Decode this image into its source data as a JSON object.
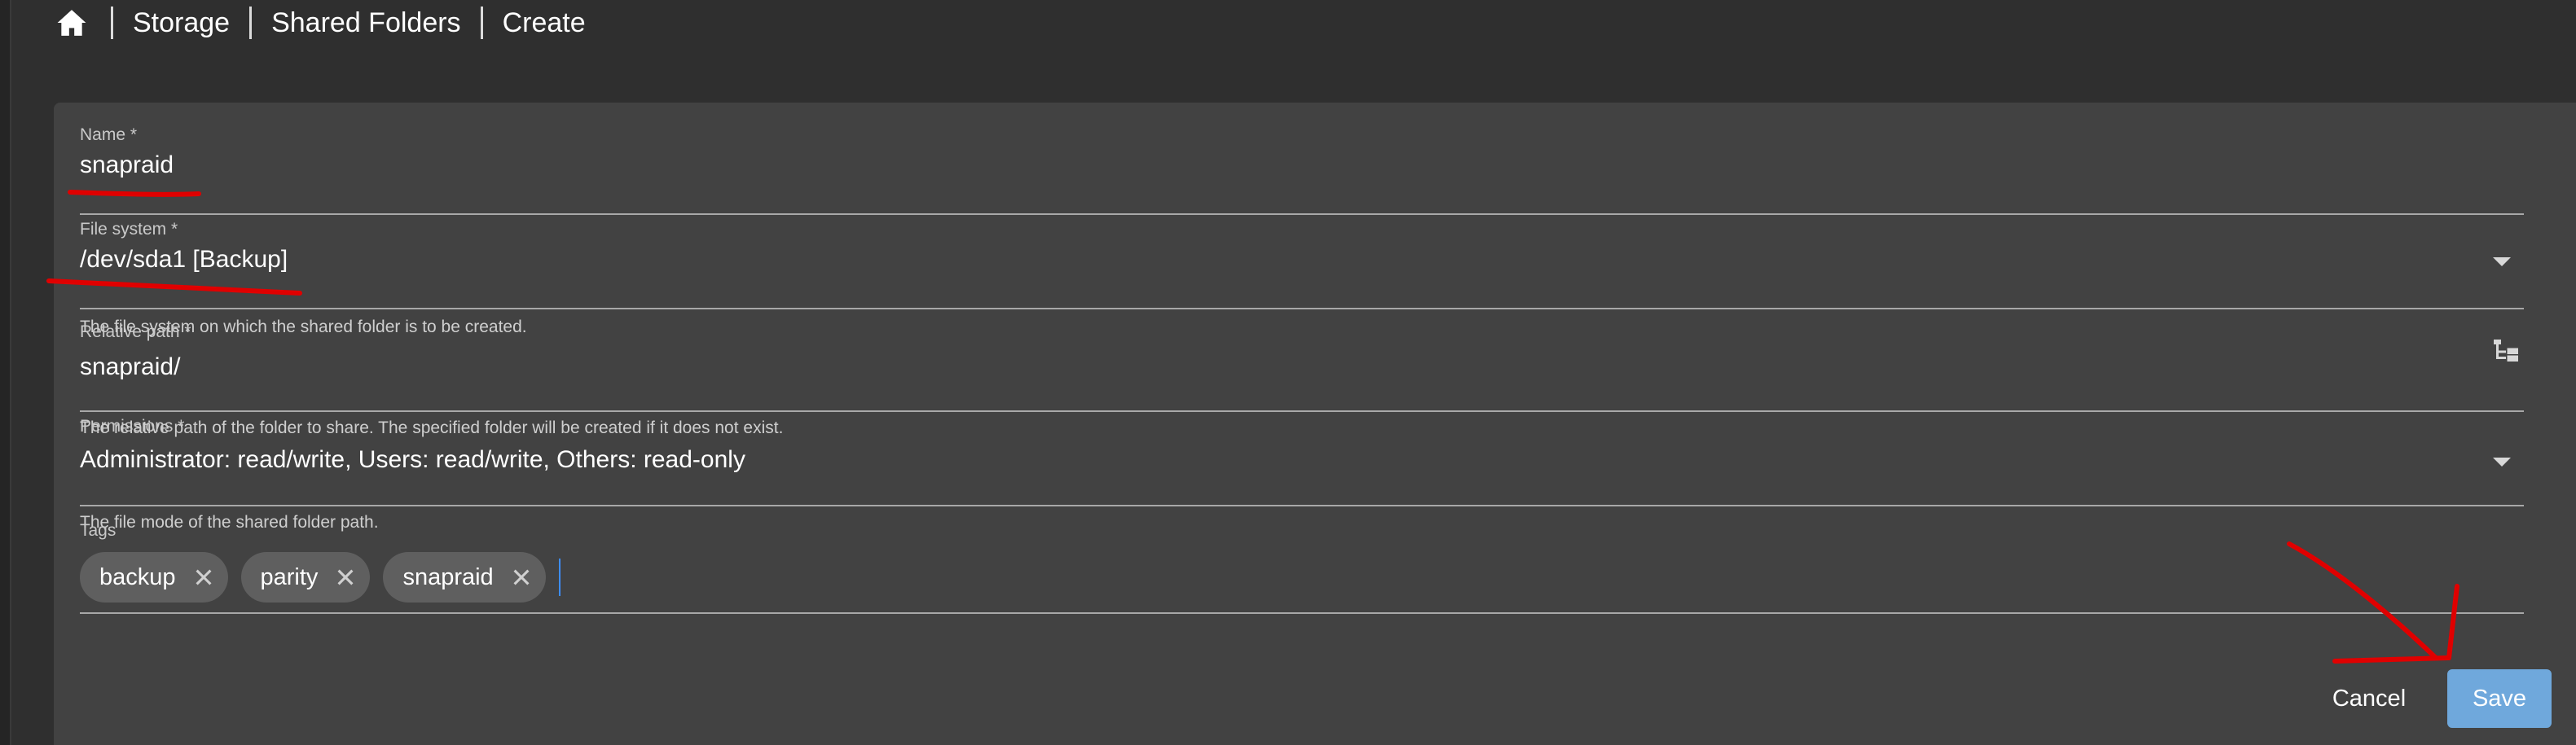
{
  "breadcrumb": {
    "home_icon": "home-icon",
    "items": [
      "Storage",
      "Shared Folders"
    ],
    "current": "Create"
  },
  "form": {
    "name": {
      "label": "Name *",
      "value": "snapraid"
    },
    "file_system": {
      "label": "File system *",
      "value": "/dev/sda1 [Backup]",
      "hint": "The file system on which the shared folder is to be created."
    },
    "relative_path": {
      "label": "Relative path *",
      "value": "snapraid/",
      "hint": "The relative path of the folder to share. The specified folder will be created if it does not exist."
    },
    "permissions": {
      "label": "Permissions *",
      "value": "Administrator: read/write, Users: read/write, Others: read-only",
      "hint": "The file mode of the shared folder path."
    },
    "tags": {
      "label": "Tags",
      "items": [
        "backup",
        "parity",
        "snapraid"
      ],
      "input_value": ""
    }
  },
  "actions": {
    "cancel_label": "Cancel",
    "save_label": "Save"
  },
  "colors": {
    "page_bg": "#2f2f2f",
    "card_bg": "#424242",
    "chip_bg": "#5f5f5f",
    "save_button": "#6fa8dc",
    "annotation_red": "#e00000",
    "cursor_blue": "#3d8dff"
  }
}
